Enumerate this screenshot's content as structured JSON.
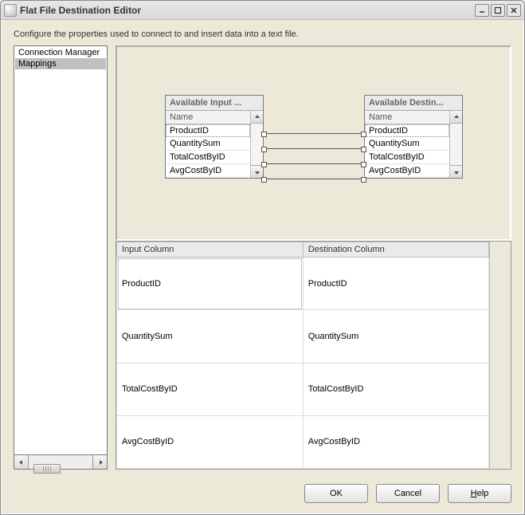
{
  "title": "Flat File Destination Editor",
  "description": "Configure the properties used to connect to and insert data into a text file.",
  "nav": {
    "items": [
      "Connection Manager",
      "Mappings"
    ],
    "selected_index": 1
  },
  "map": {
    "input_box": {
      "header": "Available Input ...",
      "col_header": "Name",
      "rows": [
        "ProductID",
        "QuantitySum",
        "TotalCostByID",
        "AvgCostByID"
      ],
      "selected_index": 0
    },
    "dest_box": {
      "header": "Available Destin...",
      "col_header": "Name",
      "rows": [
        "ProductID",
        "QuantitySum",
        "TotalCostByID",
        "AvgCostByID"
      ],
      "selected_index": 0
    }
  },
  "grid": {
    "headers": [
      "Input Column",
      "Destination Column"
    ],
    "rows": [
      {
        "input": "ProductID",
        "dest": "ProductID"
      },
      {
        "input": "QuantitySum",
        "dest": "QuantitySum"
      },
      {
        "input": "TotalCostByID",
        "dest": "TotalCostByID"
      },
      {
        "input": "AvgCostByID",
        "dest": "AvgCostByID"
      }
    ],
    "selected_index": 0
  },
  "buttons": {
    "ok": "OK",
    "cancel": "Cancel",
    "help": "Help"
  }
}
